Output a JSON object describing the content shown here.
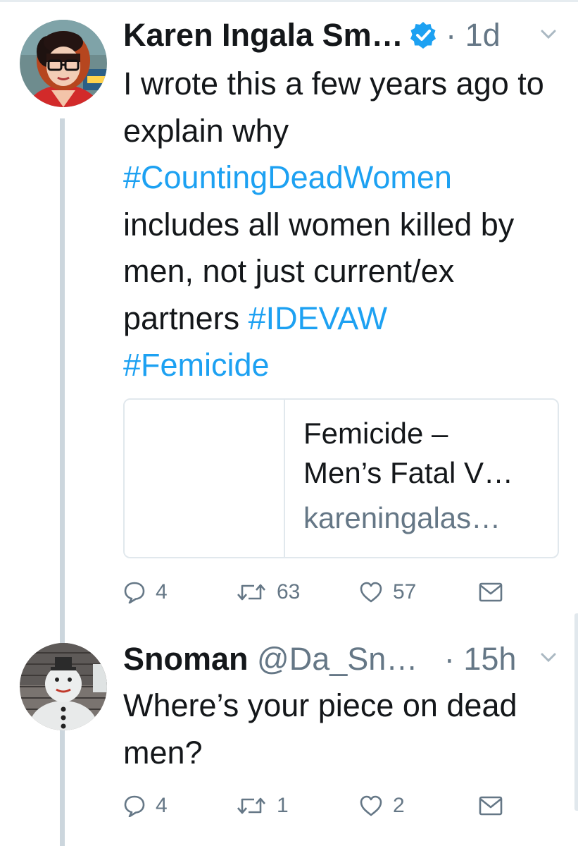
{
  "tweets": [
    {
      "name": "Karen Ingala Sm…",
      "handle": "",
      "verified": true,
      "separator": "·",
      "time": "1d",
      "text": {
        "line1": "I wrote this a few years ago to explain why ",
        "hashtag1": "#CountingDeadWomen",
        "line2": " includes all women killed by men, not just current/ex partners ",
        "hashtag2": "#IDEVAW",
        "space": " ",
        "hashtag3": "#Femicide"
      },
      "card": {
        "title": "Femicide –\nMen’s Fatal V…",
        "domain": "kareningalas…"
      },
      "actions": {
        "replies": "4",
        "retweets": "63",
        "likes": "57"
      }
    },
    {
      "name": "Snoman",
      "handle": "@Da_Sn…",
      "separator": "·",
      "time": "15h",
      "text": "Where’s your piece on dead men?",
      "actions": {
        "replies": "4",
        "retweets": "1",
        "likes": "2"
      }
    }
  ],
  "colors": {
    "link": "#1da1f2",
    "secondary_text": "#657786",
    "thread_line": "#ccd6dd",
    "verified_badge": "#1da1f2"
  },
  "icons": {
    "reply": "speech-bubble-icon",
    "retweet": "retweet-arrows-icon",
    "like": "heart-outline-icon",
    "dm": "envelope-icon",
    "more": "chevron-down-icon",
    "verified": "verified-badge-icon"
  }
}
